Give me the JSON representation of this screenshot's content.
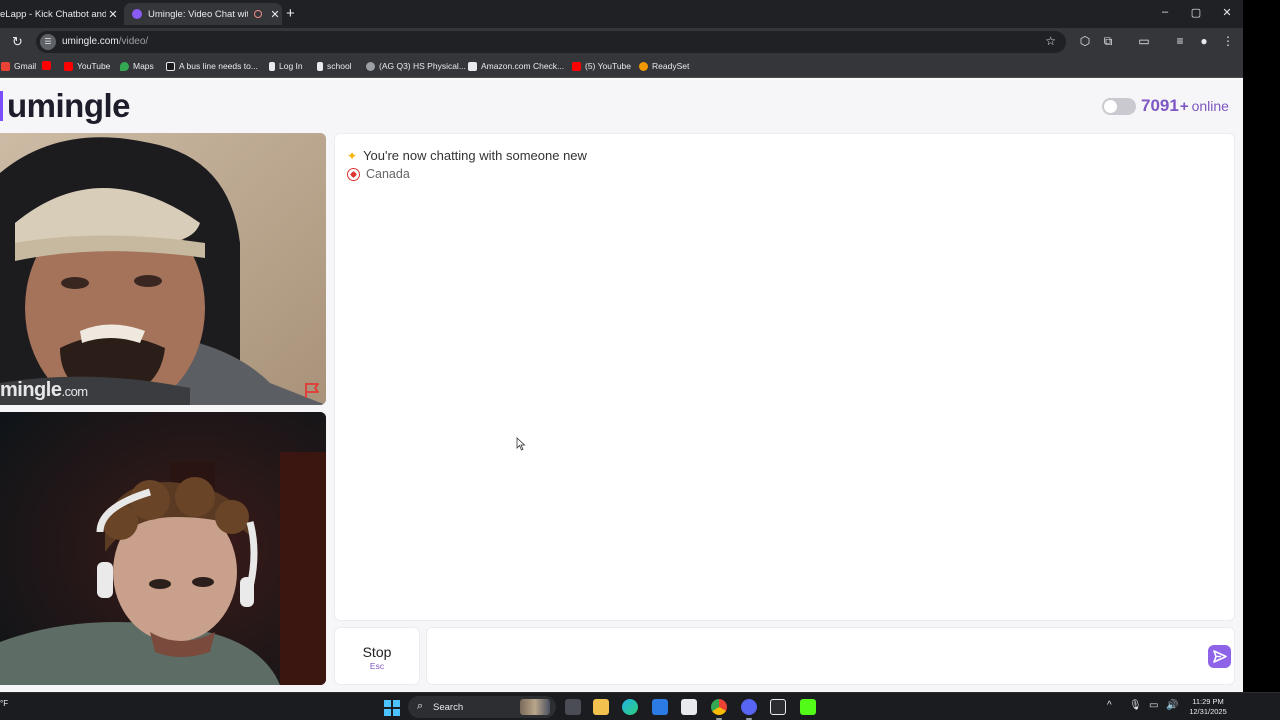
{
  "browser": {
    "tabs": [
      {
        "title": "eLapp - Kick Chatbot and",
        "active": false
      },
      {
        "title": "Umingle: Video Chat with S",
        "active": true
      }
    ],
    "address": {
      "domain": "umingle.com",
      "path": "/video/"
    },
    "bookmarks": [
      {
        "label": "Gmail",
        "icon": "gmail-icon"
      },
      {
        "label": "",
        "icon": "youtube-icon"
      },
      {
        "label": "YouTube",
        "icon": "youtube-icon"
      },
      {
        "label": "Maps",
        "icon": "maps-icon"
      },
      {
        "label": "A bus line needs to...",
        "icon": "doc-icon"
      },
      {
        "label": "Log In",
        "icon": "login-icon"
      },
      {
        "label": "school",
        "icon": "school-icon"
      },
      {
        "label": "(AG Q3) HS Physical...",
        "icon": "globe-icon"
      },
      {
        "label": "Amazon.com Check...",
        "icon": "amazon-icon"
      },
      {
        "label": "(5) YouTube",
        "icon": "youtube-icon"
      },
      {
        "label": "ReadySet",
        "icon": "readyset-icon"
      }
    ]
  },
  "site": {
    "logo": "umingle",
    "online": {
      "count": "7091",
      "plus": "+",
      "label": "online"
    },
    "watermark": {
      "brand": "mingle",
      "suffix": ".com"
    },
    "chat": {
      "status": "You're now chatting with someone new",
      "country": "Canada"
    },
    "controls": {
      "stop_label": "Stop",
      "stop_hint": "Esc",
      "message_placeholder": ""
    }
  },
  "taskbar": {
    "weather": "°F",
    "search_label": "Search",
    "time": "11:29 PM",
    "date": "12/31/2025"
  },
  "colors": {
    "accent": "#7e57c2",
    "send_button": "#8e63e8",
    "tab_bar": "#202124",
    "toolbar": "#35363a",
    "page_bg": "#f6f6f8"
  }
}
